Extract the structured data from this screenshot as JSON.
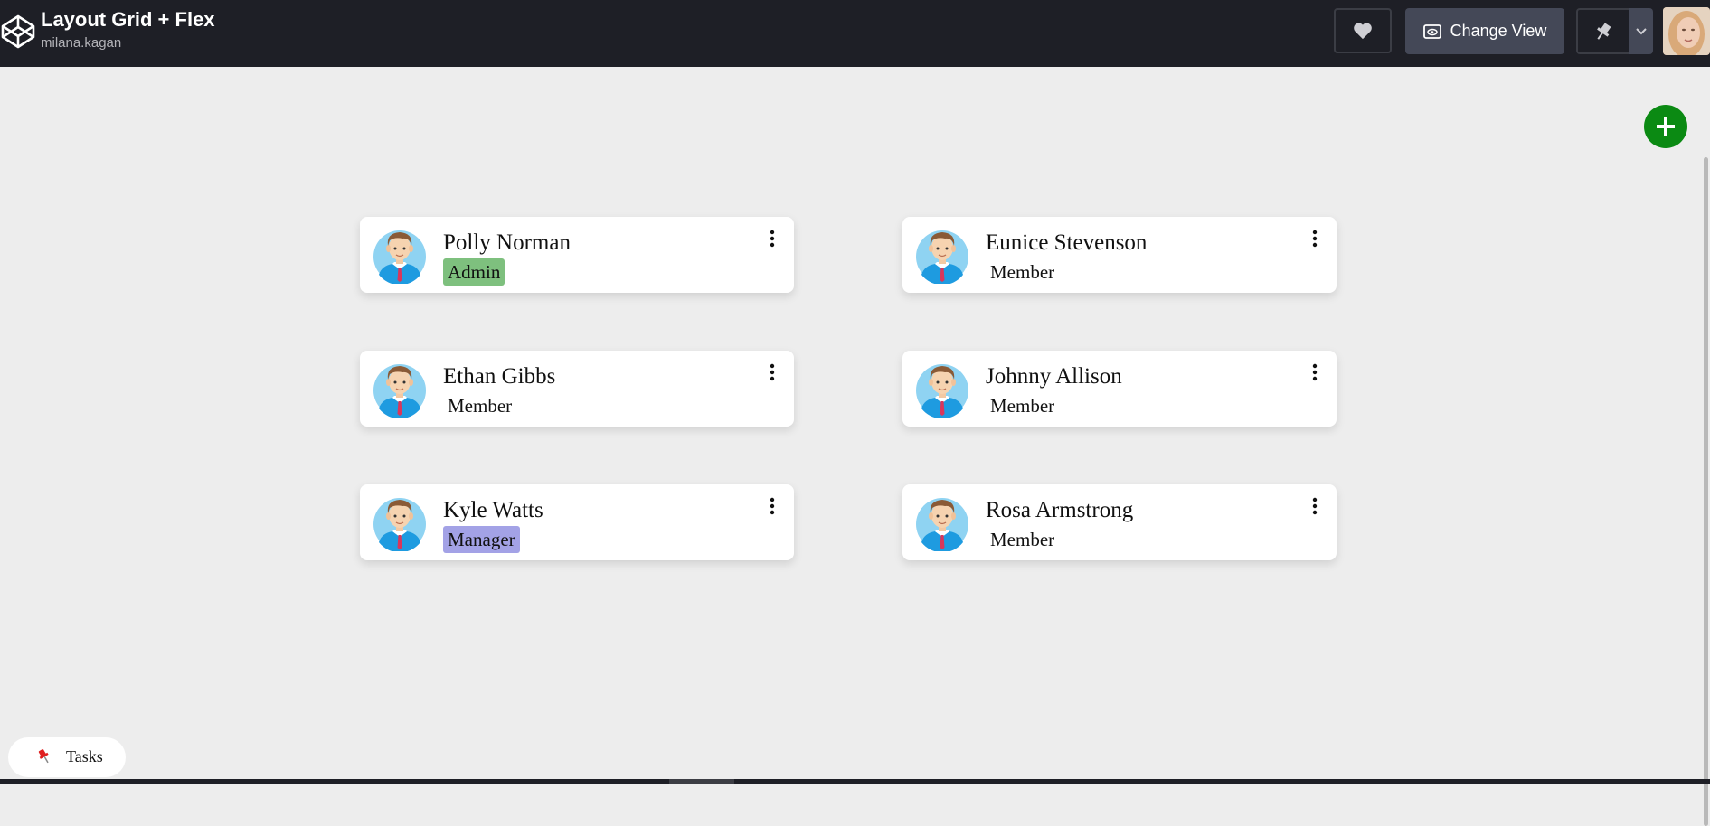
{
  "header": {
    "title": "Layout Grid + Flex",
    "username": "milana.kagan",
    "change_view_label": "Change View"
  },
  "members": [
    {
      "name": "Polly Norman",
      "role": "Admin",
      "role_color": "#7ec07e"
    },
    {
      "name": "Eunice Stevenson",
      "role": "Member",
      "role_color": ""
    },
    {
      "name": "Ethan Gibbs",
      "role": "Member",
      "role_color": ""
    },
    {
      "name": "Johnny Allison",
      "role": "Member",
      "role_color": ""
    },
    {
      "name": "Kyle Watts",
      "role": "Manager",
      "role_color": "#a3a2e6"
    },
    {
      "name": "Rosa Armstrong",
      "role": "Member",
      "role_color": ""
    }
  ],
  "tasks_label": "Tasks",
  "colors": {
    "topbar": "#1e1f26",
    "add_button": "#0b8a13",
    "background": "#ededed"
  }
}
